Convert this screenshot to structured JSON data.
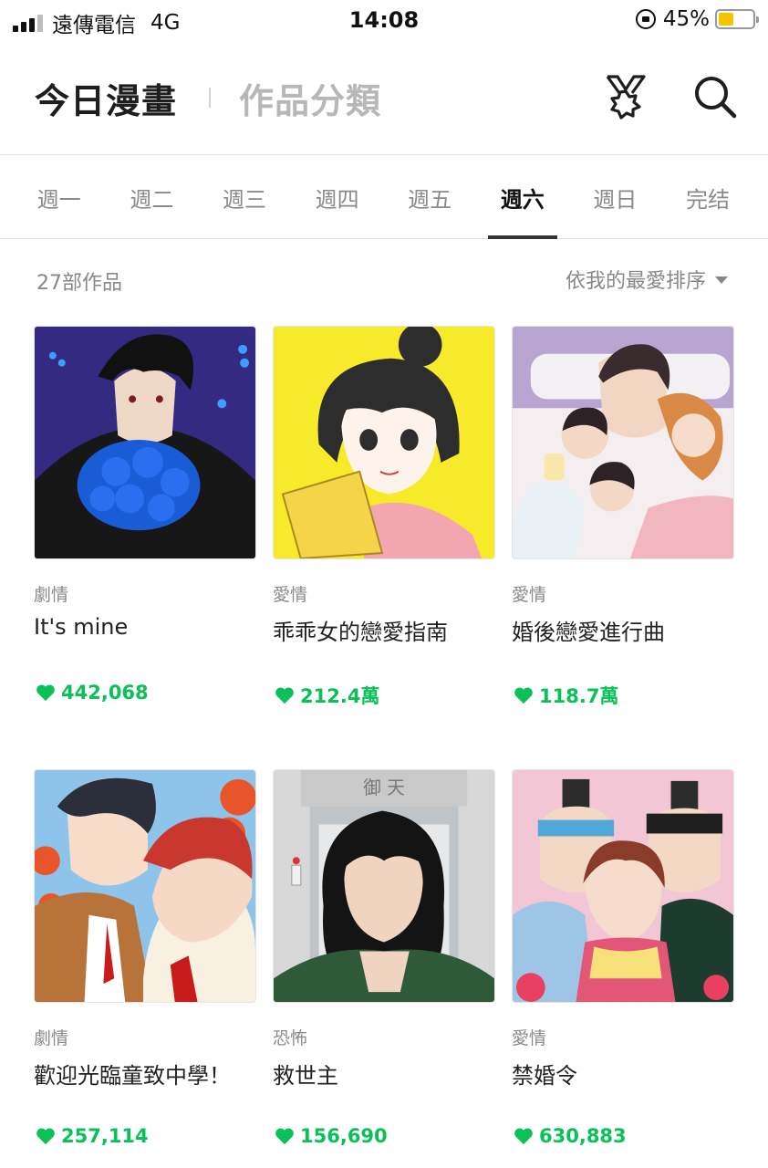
{
  "status_bar": {
    "carrier": "遠傳電信",
    "network": "4G",
    "time": "14:08",
    "battery_pct": "45%",
    "battery_level": 0.45
  },
  "header": {
    "title": "今日漫畫",
    "category": "作品分類"
  },
  "tabs": [
    "週一",
    "週二",
    "週三",
    "週四",
    "週五",
    "週六",
    "週日",
    "完结"
  ],
  "active_tab": "週六",
  "list": {
    "count": "27部作品",
    "sort": "依我的最愛排序"
  },
  "comics": [
    {
      "genre": "劇情",
      "title": "It's mine",
      "likes": "442,068"
    },
    {
      "genre": "愛情",
      "title": "乖乖女的戀愛指南",
      "likes": "212.4萬"
    },
    {
      "genre": "愛情",
      "title": "婚後戀愛進行曲",
      "likes": "118.7萬"
    },
    {
      "genre": "劇情",
      "title": "歡迎光臨童致中學！",
      "likes": "257,114"
    },
    {
      "genre": "恐怖",
      "title": "救世主",
      "likes": "156,690"
    },
    {
      "genre": "愛情",
      "title": "禁婚令",
      "likes": "630,883"
    }
  ],
  "colors": {
    "accent_green": "#0bc058",
    "tab_indicator": "#333333",
    "battery": "#f5c400"
  },
  "thumbnail_sign": "御 天"
}
